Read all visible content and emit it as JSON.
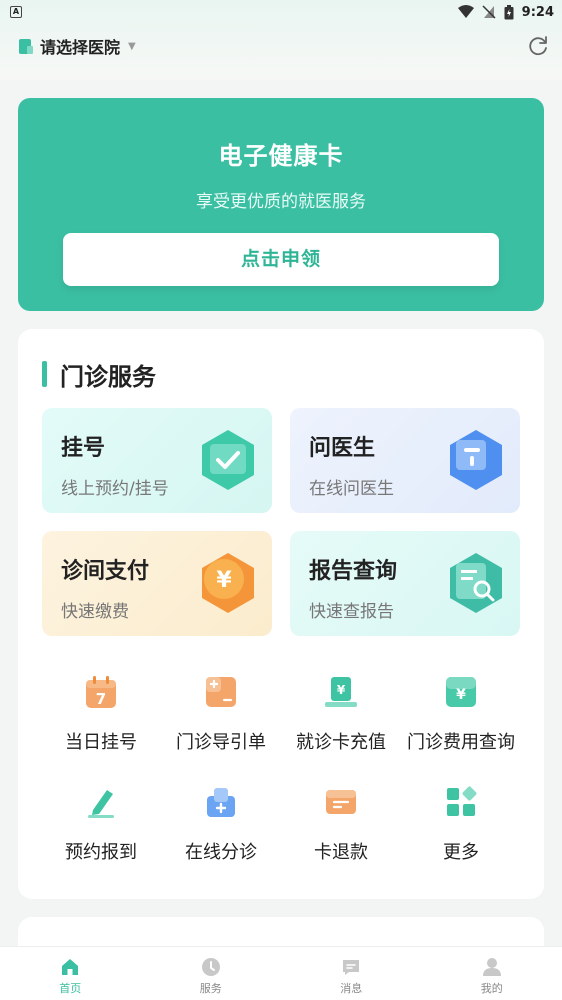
{
  "status_bar": {
    "app_icon_letter": "A",
    "time": "9:24"
  },
  "header": {
    "hospital_selector": "请选择医院"
  },
  "health_card": {
    "title": "电子健康卡",
    "subtitle": "享受更优质的就医服务",
    "button_label": "点击申领"
  },
  "outpatient": {
    "section_title": "门诊服务",
    "big_cards": [
      {
        "title": "挂号",
        "subtitle": "线上预约/挂号"
      },
      {
        "title": "问医生",
        "subtitle": "在线问医生"
      },
      {
        "title": "诊间支付",
        "subtitle": "快速缴费"
      },
      {
        "title": "报告查询",
        "subtitle": "快速查报告"
      }
    ],
    "grid_items": [
      {
        "label": "当日挂号",
        "icon": "calendar-icon"
      },
      {
        "label": "门诊导引单",
        "icon": "guide-sheet-icon"
      },
      {
        "label": "就诊卡充值",
        "icon": "card-recharge-icon"
      },
      {
        "label": "门诊费用查询",
        "icon": "fee-query-icon"
      },
      {
        "label": "预约报到",
        "icon": "check-in-pen-icon"
      },
      {
        "label": "在线分诊",
        "icon": "triage-icon"
      },
      {
        "label": "卡退款",
        "icon": "card-refund-icon"
      },
      {
        "label": "更多",
        "icon": "more-grid-icon"
      }
    ]
  },
  "tabbar": {
    "tabs": [
      {
        "label": "首页",
        "active": true
      },
      {
        "label": "服务",
        "active": false
      },
      {
        "label": "消息",
        "active": false
      },
      {
        "label": "我的",
        "active": false
      }
    ]
  },
  "colors": {
    "brand": "#3bbfa3",
    "card_blue_bg": "#eef3fd",
    "card_cyan_bg": "#e5fbfa",
    "card_orange_bg": "#fdf4e3",
    "card_mint_bg": "#e6fbf8"
  }
}
